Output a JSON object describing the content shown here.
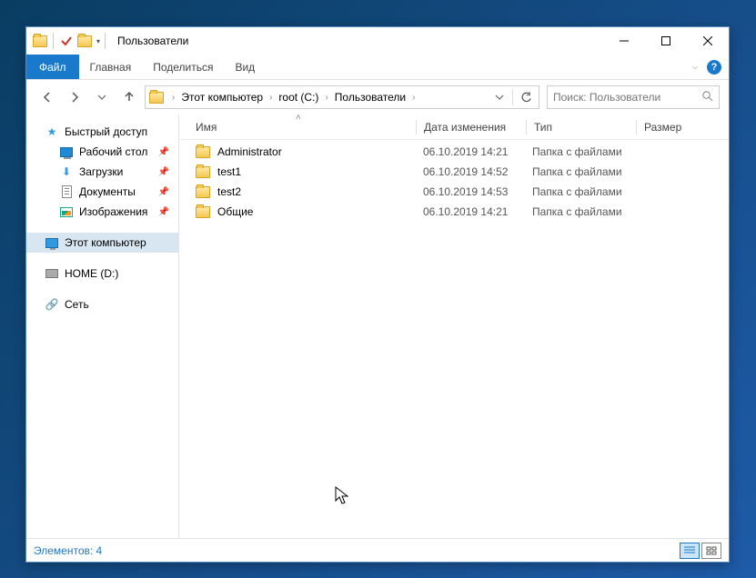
{
  "window": {
    "title": "Пользователи"
  },
  "ribbon": {
    "file_tab": "Файл",
    "tabs": [
      "Главная",
      "Поделиться",
      "Вид"
    ]
  },
  "breadcrumbs": [
    "Этот компьютер",
    "root (C:)",
    "Пользователи"
  ],
  "search": {
    "placeholder": "Поиск: Пользователи"
  },
  "sidebar": {
    "quick": "Быстрый доступ",
    "items": [
      {
        "label": "Рабочий стол",
        "pinned": true
      },
      {
        "label": "Загрузки",
        "pinned": true
      },
      {
        "label": "Документы",
        "pinned": true
      },
      {
        "label": "Изображения",
        "pinned": true
      }
    ],
    "thispc": "Этот компьютер",
    "drive": "HOME (D:)",
    "network": "Сеть"
  },
  "columns": {
    "name": "Имя",
    "date": "Дата изменения",
    "type": "Тип",
    "size": "Размер"
  },
  "rows": [
    {
      "name": "Administrator",
      "date": "06.10.2019 14:21",
      "type": "Папка с файлами"
    },
    {
      "name": "test1",
      "date": "06.10.2019 14:52",
      "type": "Папка с файлами"
    },
    {
      "name": "test2",
      "date": "06.10.2019 14:53",
      "type": "Папка с файлами"
    },
    {
      "name": "Общие",
      "date": "06.10.2019 14:21",
      "type": "Папка с файлами"
    }
  ],
  "status": {
    "text": "Элементов: 4"
  }
}
